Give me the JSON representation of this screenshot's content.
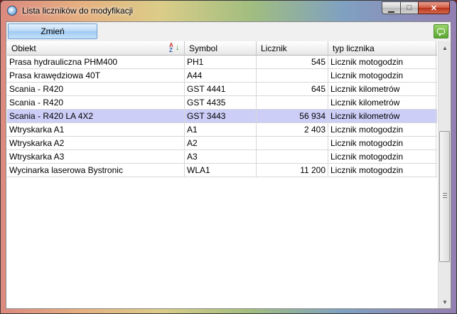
{
  "window": {
    "title": "Lista liczników do modyfikacji",
    "minimize_glyph": "▁",
    "maximize_glyph": "□",
    "close_glyph": "✕"
  },
  "toolbar": {
    "change_label": "Zmień",
    "comment_icon": "speech-bubble-icon"
  },
  "table": {
    "columns": [
      "Obiekt",
      "Symbol",
      "Licznik",
      "typ licznika"
    ],
    "sort_icon": "sort-az-icon",
    "rows": [
      {
        "obiekt": "Prasa hydrauliczna PHM400",
        "symbol": "PH1",
        "licznik": "545",
        "typ": "Licznik motogodzin",
        "selected": false
      },
      {
        "obiekt": "Prasa krawędziowa 40T",
        "symbol": "A44",
        "licznik": "",
        "typ": "Licznik motogodzin",
        "selected": false
      },
      {
        "obiekt": "Scania - R420",
        "symbol": "GST 4441",
        "licznik": "645",
        "typ": "Licznik kilometrów",
        "selected": false
      },
      {
        "obiekt": "Scania - R420",
        "symbol": "GST 4435",
        "licznik": "",
        "typ": "Licznik kilometrów",
        "selected": false
      },
      {
        "obiekt": "Scania - R420 LA 4X2",
        "symbol": "GST 3443",
        "licznik": "56 934",
        "typ": "Licznik kilometrów",
        "selected": true
      },
      {
        "obiekt": "Wtryskarka A1",
        "symbol": "A1",
        "licznik": "2 403",
        "typ": "Licznik motogodzin",
        "selected": false
      },
      {
        "obiekt": "Wtryskarka A2",
        "symbol": "A2",
        "licznik": "",
        "typ": "Licznik motogodzin",
        "selected": false
      },
      {
        "obiekt": "Wtryskarka A3",
        "symbol": "A3",
        "licznik": "",
        "typ": "Licznik motogodzin",
        "selected": false
      },
      {
        "obiekt": "Wycinarka laserowa Bystronic",
        "symbol": "WLA1",
        "licznik": "11 200",
        "typ": "Licznik motogodzin",
        "selected": false
      }
    ]
  },
  "colors": {
    "selected_row": "#cccef7",
    "button_blue": "#9fcaf2",
    "comment_green": "#5aa832"
  }
}
